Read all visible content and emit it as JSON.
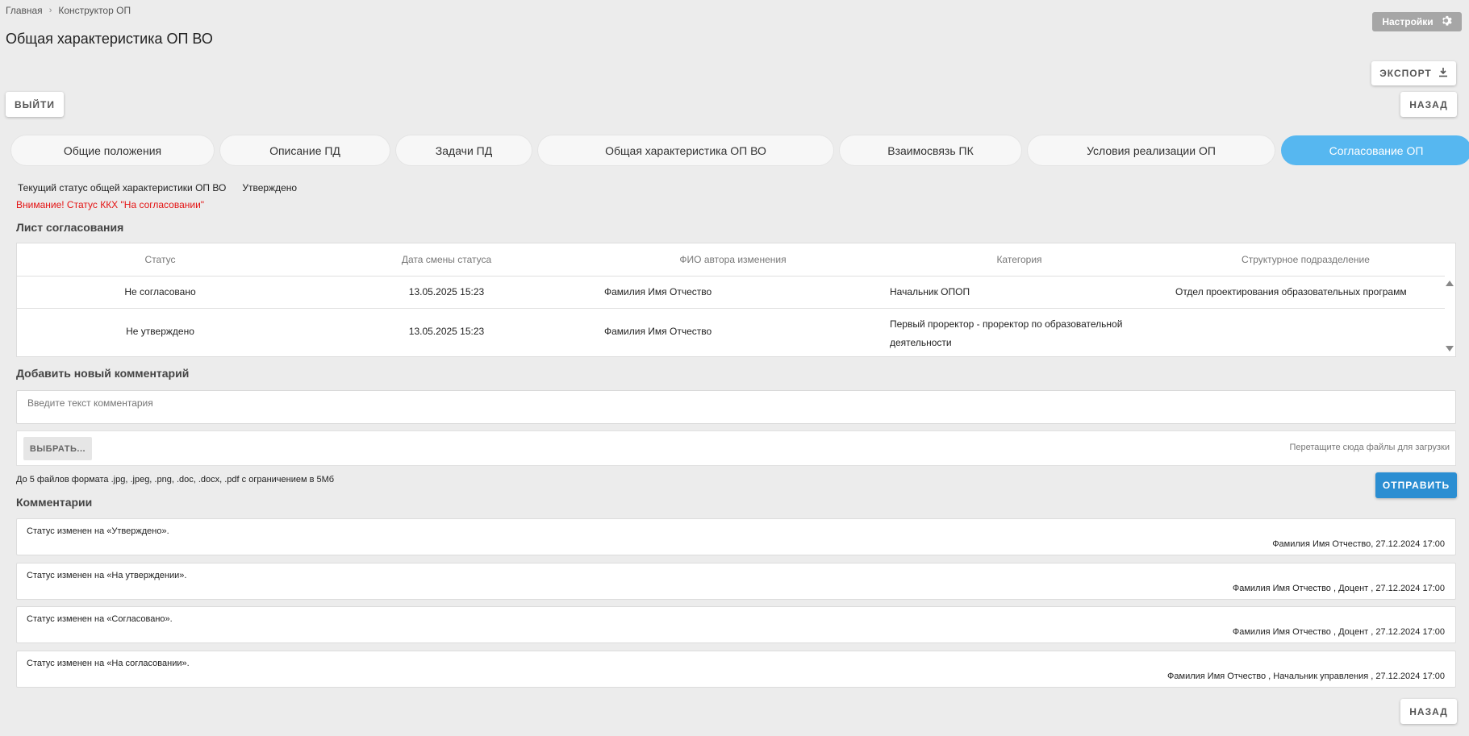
{
  "breadcrumb": {
    "home": "Главная",
    "separator": "›",
    "current": "Конструктор ОП"
  },
  "page_title": "Общая характеристика ОП ВО",
  "settings_label": "Настройки",
  "export_label": "ЭКСПОРТ",
  "exit_label": "ВЫЙТИ",
  "back_label": "НАЗАД",
  "tabs": [
    {
      "label": "Общие положения"
    },
    {
      "label": "Описание ПД"
    },
    {
      "label": "Задачи ПД"
    },
    {
      "label": "Общая характеристика ОП ВО"
    },
    {
      "label": "Взаимосвязь ПК"
    },
    {
      "label": "Условия реализации ОП"
    },
    {
      "label": "Согласование ОП",
      "active": true
    }
  ],
  "status": {
    "label": "Текущий статус общей характеристики ОП ВО",
    "value": "Утверждено"
  },
  "warning": "Внимание! Статус ККХ \"На согласовании\"",
  "approval_sheet": {
    "title": "Лист согласования",
    "columns": [
      "Статус",
      "Дата смены статуса",
      "ФИО автора изменения",
      "Категория",
      "Структурное подразделение"
    ],
    "rows": [
      [
        "Не согласовано",
        "13.05.2025 15:23",
        "Фамилия Имя Отчество",
        "Начальник ОПОП",
        "Отдел проектирования образовательных программ"
      ],
      [
        "Не утверждено",
        "13.05.2025 15:23",
        "Фамилия Имя Отчество",
        "Первый проректор - проректор по образовательной деятельности",
        ""
      ]
    ]
  },
  "new_comment": {
    "title": "Добавить новый комментарий",
    "placeholder": "Введите текст комментария",
    "choose_label": "ВЫБРАТЬ...",
    "drop_hint": "Перетащите сюда файлы для загрузки",
    "file_hint": "До 5 файлов формата .jpg, .jpeg, .png, .doc, .docx, .pdf с ограничением в 5Мб",
    "send_label": "ОТПРАВИТЬ"
  },
  "comments": {
    "title": "Комментарии",
    "items": [
      {
        "text": "Статус изменен на «Утверждено».",
        "meta": "Фамилия Имя Отчество, 27.12.2024 17:00"
      },
      {
        "text": "Статус изменен на «На утверждении».",
        "meta": "Фамилия Имя Отчество , Доцент , 27.12.2024 17:00"
      },
      {
        "text": "Статус изменен на «Согласовано».",
        "meta": "Фамилия Имя Отчество , Доцент , 27.12.2024 17:00"
      },
      {
        "text": "Статус изменен на «На согласовании».",
        "meta": "Фамилия Имя Отчество , Начальник управления , 27.12.2024 17:00"
      }
    ]
  },
  "colors": {
    "accent": "#56b7f0",
    "send_button": "#2b8ed2",
    "warning": "#e41313",
    "background": "#ececec"
  },
  "icons": {
    "settings": "gear-icon",
    "export": "download-icon",
    "breadcrumb_separator": "chevron-right-icon"
  }
}
